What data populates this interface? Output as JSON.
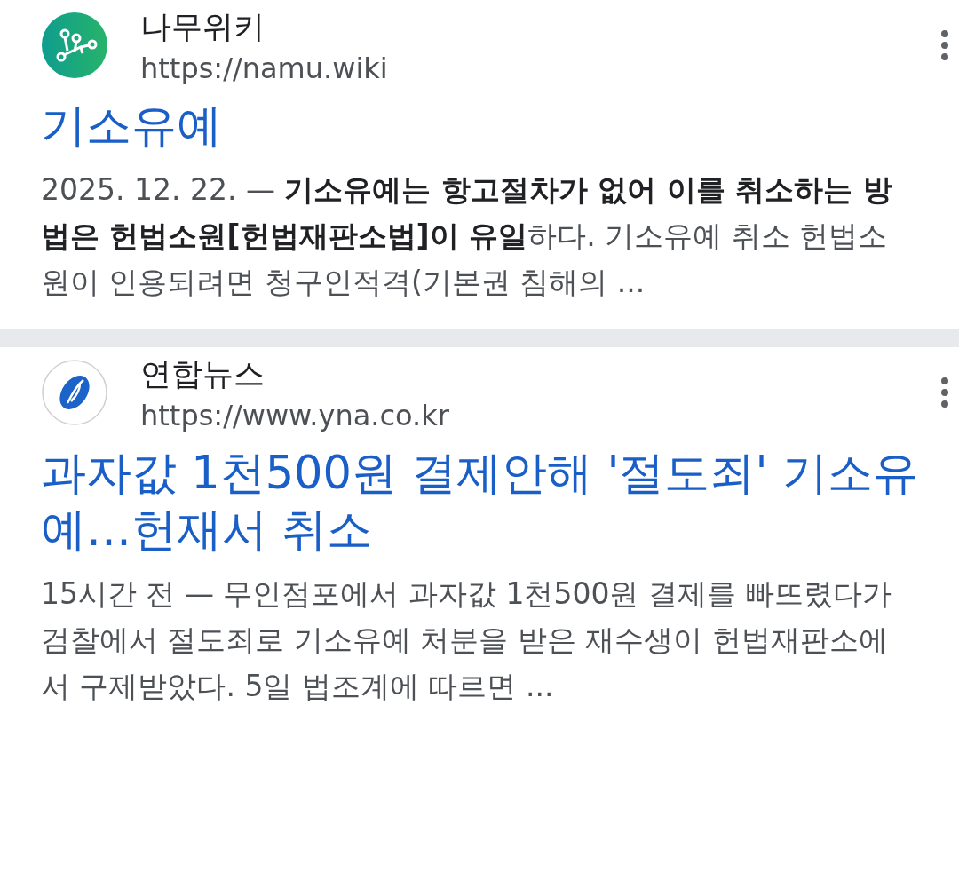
{
  "results": [
    {
      "site_name": "나무위키",
      "url": "https://namu.wiki",
      "title": "기소유예",
      "snippet": "2025. 12. 22. — **기소유예는 항고절차가 없어 이를 취소하는 방법은 헌법소원[헌법재판소법]이 유일**하다. 기소유예 취소 헌법소원이 인용되려면 청구인적격(기본권 침해의 ..."
    },
    {
      "site_name": "연합뉴스",
      "url": "https://www.yna.co.kr",
      "title": "과자값 1천500원 결제안해 '절도죄' 기소유예…헌재서 취소",
      "snippet": "15시간 전 — 무인점포에서 과자값 1천500원 결제를 빠뜨렸다가 검찰에서 절도죄로 기소유예 처분을 받은 재수생이 헌법재판소에서 구제받았다. 5일 법조계에 따르면 ..."
    }
  ]
}
